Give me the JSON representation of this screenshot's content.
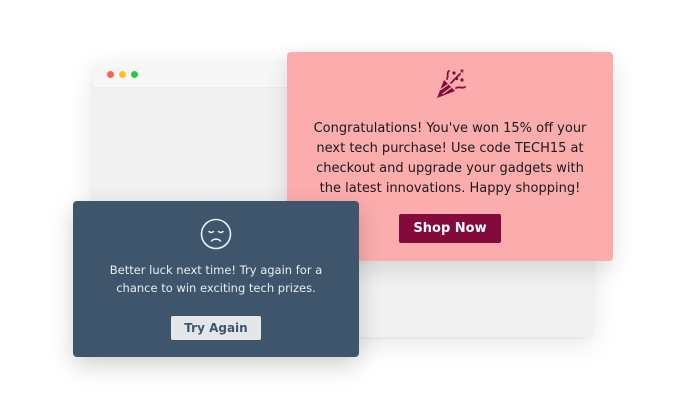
{
  "browser": {
    "window_controls": [
      "close",
      "minimize",
      "maximize"
    ]
  },
  "win_popup": {
    "icon": "party-popper-icon",
    "message": "Congratulations! You've won 15% off your next tech purchase! Use code TECH15 at checkout and upgrade your gadgets with the latest innovations. Happy shopping!",
    "button_label": "Shop Now",
    "background_color": "#fbadad",
    "button_color": "#840a3b"
  },
  "lose_popup": {
    "icon": "sad-face-icon",
    "message": "Better luck next time! Try again for a chance to win exciting tech prizes.",
    "button_label": "Try Again",
    "background_color": "#3e556b",
    "button_color": "#e4e7ea"
  }
}
